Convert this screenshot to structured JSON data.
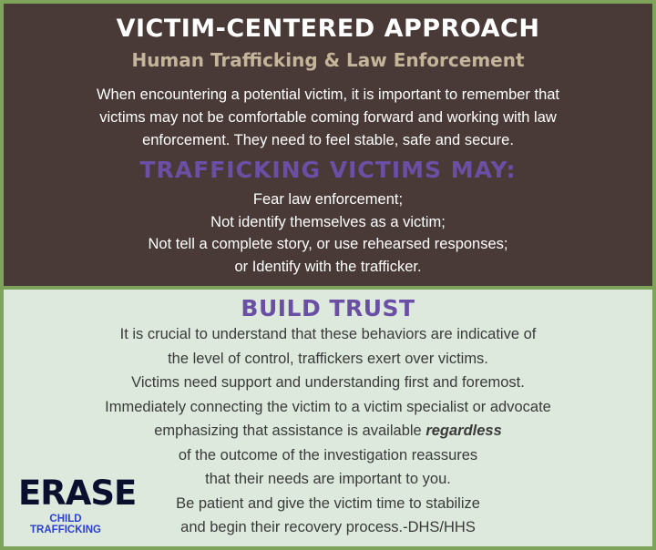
{
  "top": {
    "title": "VICTIM-CENTERED APPROACH",
    "subtitle": "Human Trafficking & Law Enforcement",
    "intro": [
      "When encountering a potential victim, it is important to remember that",
      "victims may not be comfortable coming forward and working with law",
      "enforcement. They need to feel stable, safe and secure."
    ],
    "may_heading": "TRAFFICKING VICTIMS MAY:",
    "may_items": [
      "Fear law enforcement;",
      "Not identify themselves as a victim;",
      "Not tell a complete story, or use rehearsed responses;",
      "or Identify with the trafficker."
    ]
  },
  "bottom": {
    "heading": "BUILD TRUST",
    "lines": [
      "It is crucial to understand that these behaviors are indicative of",
      "the level of control, traffickers exert over victims.",
      "Victims need support and understanding first and foremost.",
      "Immediately connecting the victim to a victim specialist or advocate"
    ],
    "line5_before": "emphasizing that assistance is available ",
    "line5_emphasis": "regardless",
    "lines_after": [
      "of the outcome of the investigation reassures",
      "that their needs are important to you.",
      "Be patient and give the victim time to stabilize",
      "and begin their recovery process.-DHS/HHS"
    ]
  },
  "logo": {
    "word": "ERASE",
    "tagline": "CHILD TRAFFICKING"
  },
  "colors": {
    "border_green": "#7ea35a",
    "top_bg": "#4a3a37",
    "bottom_bg": "#dde9dd",
    "accent_purple": "#6a4fa5",
    "subtitle_tan": "#c4b49a"
  }
}
